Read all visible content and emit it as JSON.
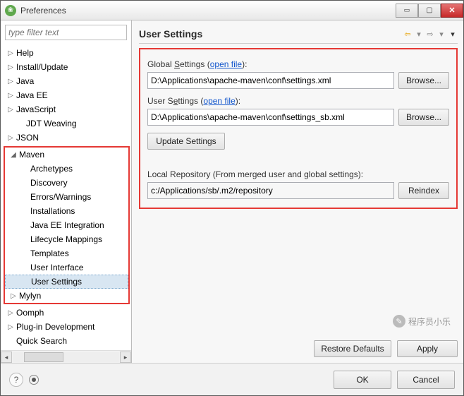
{
  "window": {
    "title": "Preferences"
  },
  "sidebar": {
    "filter_placeholder": "type filter text",
    "top_items": [
      {
        "label": "Help"
      },
      {
        "label": "Install/Update"
      },
      {
        "label": "Java"
      },
      {
        "label": "Java EE"
      },
      {
        "label": "JavaScript"
      },
      {
        "label": "JDT Weaving",
        "leaf": true
      },
      {
        "label": "JSON"
      }
    ],
    "maven": {
      "label": "Maven",
      "children": [
        "Archetypes",
        "Discovery",
        "Errors/Warnings",
        "Installations",
        "Java EE Integration",
        "Lifecycle Mappings",
        "Templates",
        "User Interface",
        "User Settings"
      ],
      "selected_index": 8
    },
    "bottom_items": [
      {
        "label": "Mylyn"
      },
      {
        "label": "Oomph"
      },
      {
        "label": "Plug-in Development"
      },
      {
        "label": "Quick Search"
      }
    ]
  },
  "page": {
    "title": "User Settings",
    "global_label_pre": "Global ",
    "global_label_u": "S",
    "global_label_post": "ettings (",
    "open_file": "open file",
    "close_paren": "):",
    "global_path": "D:\\Applications\\apache-maven\\conf\\settings.xml",
    "browse": "Browse...",
    "user_label_pre": "User S",
    "user_label_u": "e",
    "user_label_post": "ttings (",
    "user_path": "D:\\Applications\\apache-maven\\conf\\settings_sb.xml",
    "update_btn": "Update Settings",
    "local_repo_label": "Local Repository (From merged user and global settings):",
    "local_repo_path": "c:/Applications/sb/.m2/repository",
    "reindex": "Reindex",
    "restore": "Restore Defaults",
    "apply": "Apply"
  },
  "footer": {
    "ok": "OK",
    "cancel": "Cancel"
  },
  "watermark": "程序员小乐"
}
